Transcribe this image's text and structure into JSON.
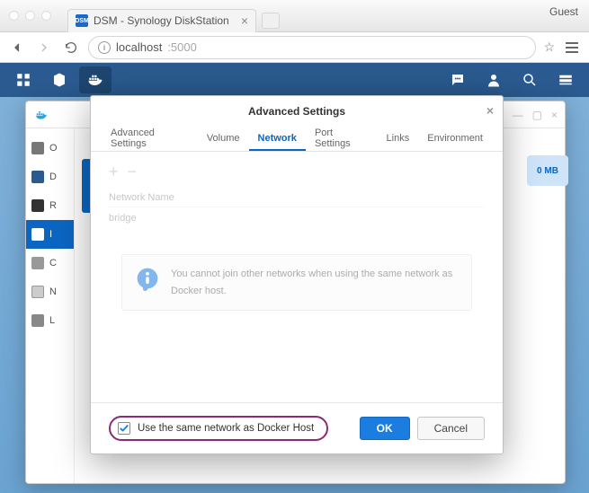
{
  "browser": {
    "tab_title": "DSM - Synology DiskStation",
    "guest_label": "Guest",
    "url_host": "localhost",
    "url_port": ":5000"
  },
  "bg_window": {
    "mb_badge": "0 MB",
    "sidebar": [
      {
        "label": "O"
      },
      {
        "label": "D"
      },
      {
        "label": "R"
      },
      {
        "label": "I"
      },
      {
        "label": "C"
      },
      {
        "label": "N"
      },
      {
        "label": "L"
      }
    ]
  },
  "modal": {
    "title": "Advanced Settings",
    "tabs": {
      "advanced": "Advanced Settings",
      "volume": "Volume",
      "network": "Network",
      "port": "Port Settings",
      "links": "Links",
      "env": "Environment"
    },
    "network": {
      "header": "Network Name",
      "row1": "bridge",
      "info": "You cannot join other networks when using the same network as Docker host."
    },
    "checkbox_label": "Use the same network as Docker Host",
    "buttons": {
      "ok": "OK",
      "cancel": "Cancel"
    }
  }
}
